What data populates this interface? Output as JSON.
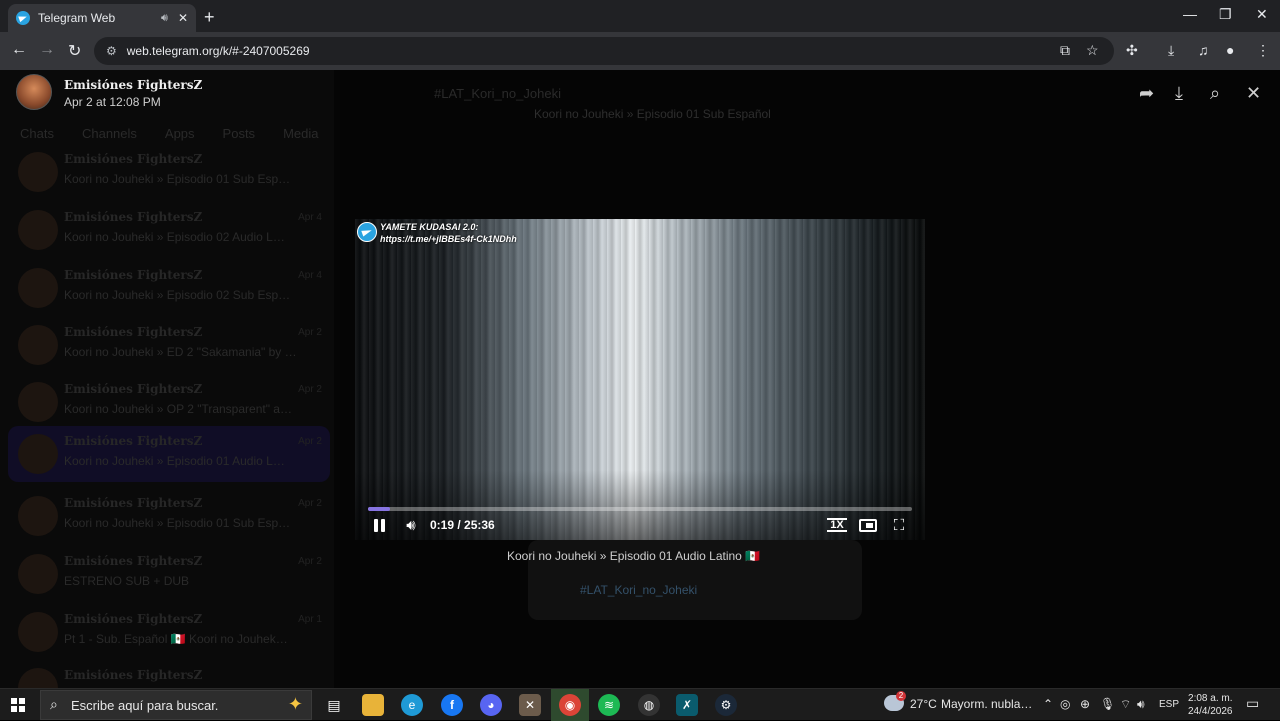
{
  "browser": {
    "tab_title": "Telegram Web",
    "url": "web.telegram.org/k/#-2407005269"
  },
  "viewer": {
    "sender_name": "Emisiónes FightersZ",
    "sender_date": "Apr 2 at 12:08 PM",
    "search_tag": "#LAT_Kori_no_Joheki"
  },
  "player": {
    "watermark_line1": "YAMETE KUDASAI 2.0:",
    "watermark_line2": "https://t.me/+jIBBEs4f-Ck1NDhh",
    "time": "0:19 / 25:36",
    "speed": "1X",
    "progress": 0.012
  },
  "chat": {
    "bubble_title": "Koori no Jouheki » Episodio 01 Sub Español",
    "caption": "Koori no Jouheki » Episodio 01 Audio Latino 🇲🇽 ",
    "hashtag": "#LAT_Kori_no_Joheki"
  },
  "sidebar": {
    "folders": [
      "Chats",
      "Channels",
      "Apps",
      "Posts",
      "Media"
    ],
    "items": [
      {
        "name": "Emisiónes FightersZ",
        "preview": "Koori no Jouheki » Episodio 01 Sub Esp…",
        "time": ""
      },
      {
        "name": "Emisiónes FightersZ",
        "preview": "Koori no Jouheki » Episodio 02 Audio L…",
        "time": "Apr 4"
      },
      {
        "name": "Emisiónes FightersZ",
        "preview": "Koori no Jouheki » Episodio 02 Sub Esp…",
        "time": "Apr 4"
      },
      {
        "name": "Emisiónes FightersZ",
        "preview": "Koori no Jouheki » ED 2 \"Sakamania\" by …",
        "time": "Apr 2"
      },
      {
        "name": "Emisiónes FightersZ",
        "preview": "Koori no Jouheki » OP 2 \"Transparent\" a…",
        "time": "Apr 2"
      },
      {
        "name": "Emisiónes FightersZ",
        "preview": "Koori no Jouheki » Episodio 01 Audio L…",
        "time": "Apr 2"
      },
      {
        "name": "Emisiónes FightersZ",
        "preview": "Koori no Jouheki » Episodio 01 Sub Esp…",
        "time": "Apr 2"
      },
      {
        "name": "Emisiónes FightersZ",
        "preview": "ESTRENO SUB + DUB",
        "time": "Apr 2"
      },
      {
        "name": "Emisiónes FightersZ",
        "preview": "Pt 1 - Sub. Español 🇲🇽 Koori no Jouhek…",
        "time": "Apr 1"
      },
      {
        "name": "Emisiónes FightersZ",
        "preview": "",
        "time": ""
      }
    ]
  },
  "taskbar": {
    "search_placeholder": "Escribe aquí para buscar.",
    "weather_temp": "27°C",
    "weather_desc": "Mayorm. nubla…",
    "weather_badge": "2",
    "lang": "ESP",
    "time": "2:08 a. m.",
    "date": "24/4/2026"
  },
  "colors": {
    "accent": "#8774e1",
    "telegram_blue": "#2aa3e0",
    "chrome_dark": "#202124"
  }
}
